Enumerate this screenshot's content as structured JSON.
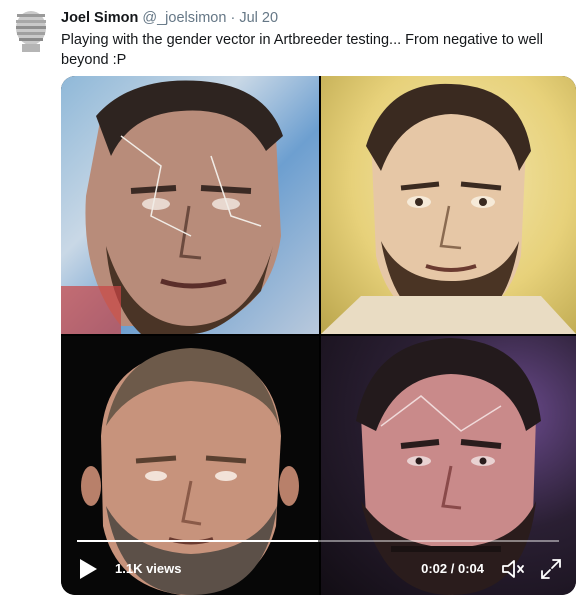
{
  "tweet": {
    "author_name": "Joel Simon",
    "author_handle": "@_joelsimon",
    "separator": "·",
    "date": "Jul 20",
    "text": "Playing with the gender vector in Artbreeder testing... From negative to well beyond :P"
  },
  "video": {
    "views": "1.1K views",
    "time": "0:02 / 0:04",
    "progress": 0.5
  },
  "icons": {
    "avatar": "avatar-sculpture-icon",
    "play": "play-icon",
    "volume": "volume-icon",
    "fullscreen": "fullscreen-icon"
  }
}
